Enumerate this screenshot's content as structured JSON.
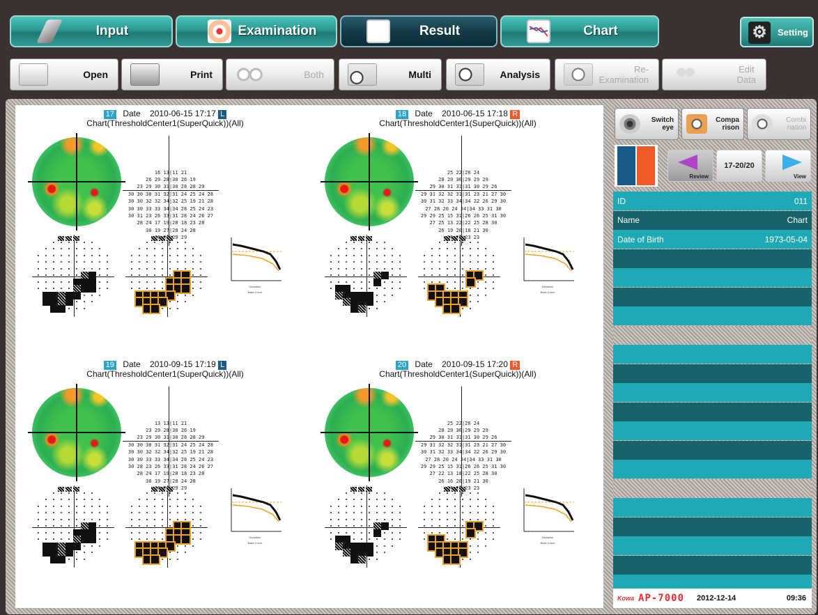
{
  "toolbar": {
    "tabs": [
      {
        "label": "Input",
        "icon": "pen-icon"
      },
      {
        "label": "Examination",
        "icon": "eye-target-icon"
      },
      {
        "label": "Result",
        "icon": "result-grid-icon"
      },
      {
        "label": "Chart",
        "icon": "line-chart-icon"
      }
    ],
    "setting_label": "Setting",
    "actions": [
      {
        "label": "Open",
        "icon": "book-icon"
      },
      {
        "label": "Print",
        "icon": "printer-icon"
      },
      {
        "label": "Both",
        "icon": "both-eyes-icon"
      },
      {
        "label": "Multi",
        "icon": "multi-icon"
      },
      {
        "label": "Analysis",
        "icon": "analysis-icon"
      },
      {
        "label": "Re-\nExamination",
        "icon": "reexam-icon"
      },
      {
        "label": "Edit\nData",
        "icon": "people-icon"
      }
    ]
  },
  "exams": [
    {
      "num": "17",
      "date_label": "Date",
      "date": "2010-06-15 17:17",
      "eye": "L",
      "subtitle": "Chart(ThresholdCenter1(SuperQuick))(All)",
      "thresholds": "16 13|11 21\n26 29 28|30 26 19\n23 29 30 31|30 28 28 29\n30 30 30 31 32|31 24 25 24 28\n30 30 32 32 34|32 25 19 21 28\n30 30 33 33 34|34 28 25 24 23\n30 31 23 26 33|31 28 24 26 27\n28 24 17 19|20 18 23 28\n30 19 27|28 24 28\n26 26|29 29",
      "curve_labels": [
        "Deviation",
        "Base Curve"
      ]
    },
    {
      "num": "18",
      "date_label": "Date",
      "date": "2010-06-15 17:18",
      "eye": "R",
      "subtitle": "Chart(ThresholdCenter1(SuperQuick))(All)",
      "thresholds": "25 22|26 24\n28 29 30|29 29 29\n29 30 31 31|31 30 29 26\n29 31 32 32 31|31 23 21 27 30\n30 31 32 33 34|34 22 26 29 30\n27 28 20 24 34|34 33 31 30\n29 29 25 15 31|26 26 25 31 30\n27 25 13 22|22 25 28 30\n26 19 20|18 21 30\n26 23|23 23",
      "curve_labels": [
        "Deviation",
        "Base Curve"
      ]
    },
    {
      "num": "19",
      "date_label": "Date",
      "date": "2010-09-15 17:19",
      "eye": "L",
      "subtitle": "Chart(ThresholdCenter1(SuperQuick))(All)",
      "thresholds": "13 13|11 21\n23 29 28|30 26 19\n23 29 30 31|30 28 28 29\n30 30 30 31 32|31 24 25 24 28\n30 30 32 32 34|32 25 19 21 28\n30 30 33 33 34|34 28 25 24 23\n30 28 23 26 33|31 28 24 26 27\n28 24 17 19|20 18 23 28\n30 19 27|28 24 28\n26 26|29 29",
      "curve_labels": [
        "Deviation",
        "Base Curve"
      ]
    },
    {
      "num": "20",
      "date_label": "Date",
      "date": "2010-09-15 17:20",
      "eye": "R",
      "subtitle": "Chart(ThresholdCenter1(SuperQuick))(All)",
      "thresholds": "25 22|26 24\n28 29 30|29 29 29\n29 30 31 31|31 30 29 26\n29 31 32 32 31|31 23 21 27 30\n30 31 32 33 34|34 22 26 29 30\n27 28 20 24 34|34 33 31 30\n29 29 25 15 31|26 26 25 31 30\n27 22 13 18|22 25 28 30\n26 16 20|19 21 30\n26 23|23 23",
      "curve_labels": [
        "Deviation",
        "Base Curve"
      ]
    }
  ],
  "sidebar": {
    "tools": [
      {
        "label": "Switch\neye",
        "icon": "switch-eye-icon"
      },
      {
        "label": "Compa\nrison",
        "icon": "comparison-icon"
      },
      {
        "label": "Combi\nnation",
        "icon": "combination-icon"
      }
    ],
    "review_label": "Review",
    "range_label": "17-20/20",
    "view_label": "View",
    "patient": [
      {
        "label": "ID",
        "value": "011"
      },
      {
        "label": "Name",
        "value": "Chart"
      },
      {
        "label": "Date of Birth",
        "value": "1973-05-04"
      }
    ],
    "colors": {
      "teal": "#1fa9b4",
      "dark_teal": "#18626a",
      "left_eye": "#1a5a8a",
      "right_eye": "#f05a28"
    }
  },
  "footer": {
    "brand": "Kowa",
    "model": "AP-7000",
    "date": "2012-12-14",
    "time": "09:36"
  }
}
